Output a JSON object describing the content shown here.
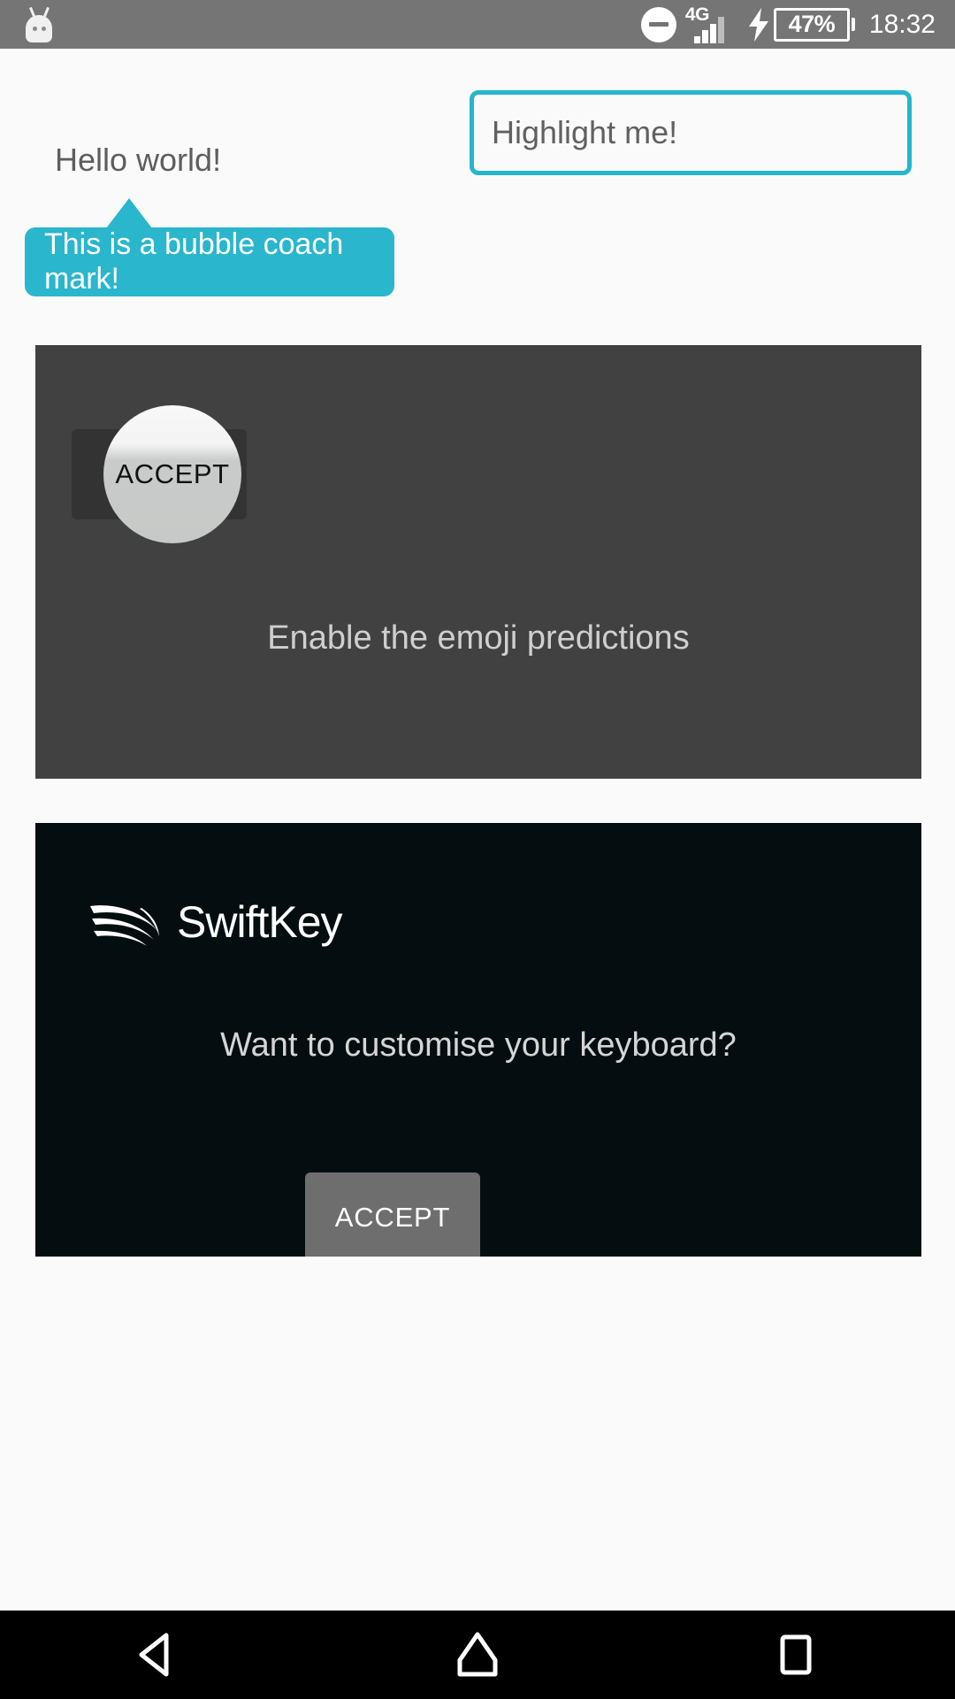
{
  "status_bar": {
    "notification_icon": "cyanogenmod-droid-icon",
    "dnd_icon": "do-not-disturb-icon",
    "network_type": "4G",
    "signal_icon": "signal-bars-icon",
    "charging_icon": "charging-bolt-icon",
    "battery_level": "47%",
    "time": "18:32"
  },
  "screen": {
    "hello_text": "Hello world!",
    "highlight_field_value": "Highlight me!",
    "bubble_text": "This is a bubble coach mark!"
  },
  "overlay": {
    "button_label": "ACCEPT",
    "caption": "Enable the emoji predictions"
  },
  "swiftkey": {
    "logo_mark": "swiftkey-swoosh-icon",
    "brand_name": "SwiftKey",
    "question": "Want to customise your keyboard?",
    "accept_label": "ACCEPT"
  },
  "nav_bar": {
    "back": "back-icon",
    "home": "home-icon",
    "recents": "recents-icon"
  },
  "colors": {
    "accent_cyan": "#2ab6cc",
    "status_bar": "#757575",
    "overlay_dark": "#414141",
    "swiftkey_bg": "#040e10",
    "accept_gray": "#6e6e6e"
  }
}
